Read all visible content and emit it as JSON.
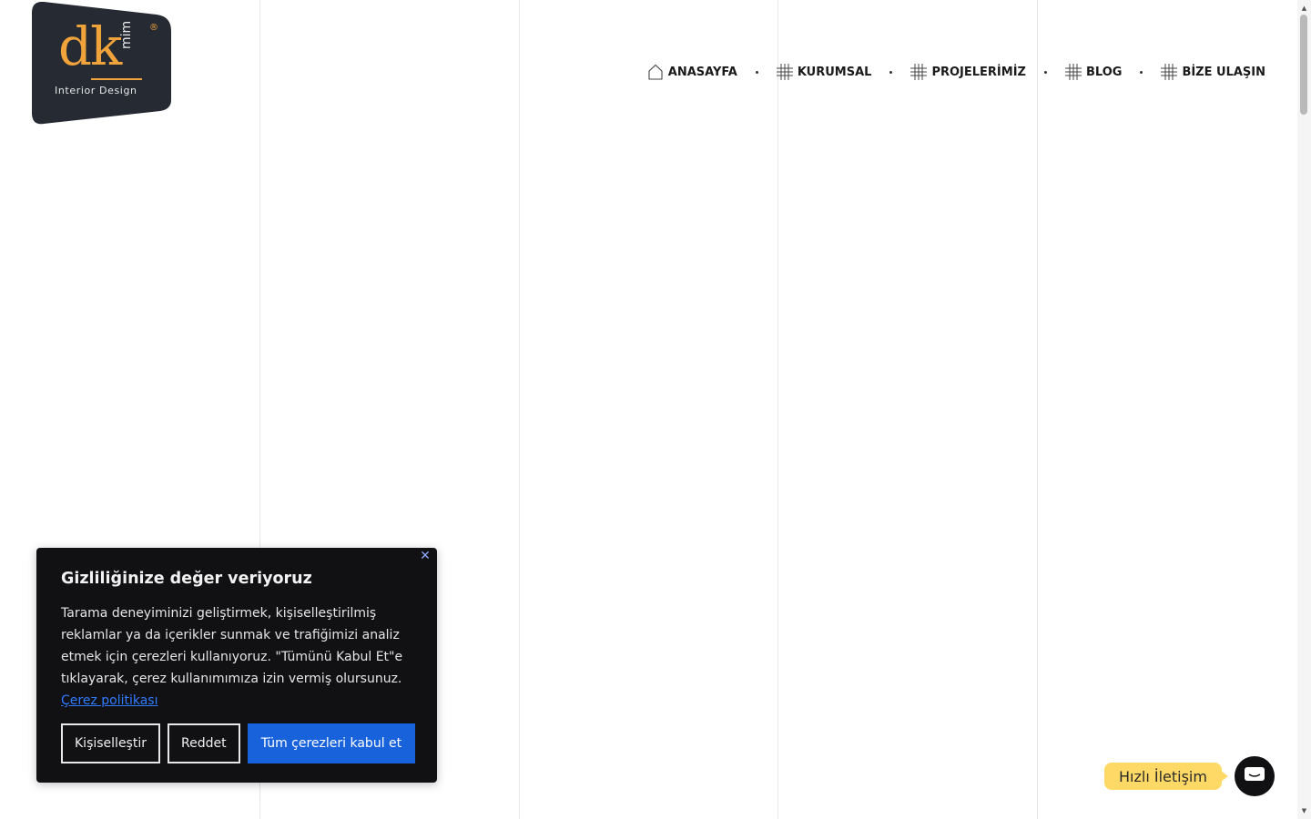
{
  "logo": {
    "brand": "dk",
    "brand_suffix": "mim",
    "registered": "®",
    "tagline": "Interior Design"
  },
  "nav": {
    "items": [
      {
        "label": "ANASAYFA",
        "icon": "home-icon"
      },
      {
        "label": "KURUMSAL",
        "icon": "grid-icon"
      },
      {
        "label": "PROJELERİMİZ",
        "icon": "grid-icon"
      },
      {
        "label": "BLOG",
        "icon": "grid-icon"
      },
      {
        "label": "BİZE ULAŞIN",
        "icon": "grid-icon"
      }
    ]
  },
  "cookie": {
    "title": "Gizliliğinize değer veriyoruz",
    "text": "Tarama deneyiminizi geliştirmek, kişiselleştirilmiş reklamlar ya da içerikler sunmak ve trafiğimizi analiz etmek için çerezleri kullanıyoruz. \"Tümünü Kabul Et\"e tıklayarak, çerez kullanımımıza izin vermiş olursunuz.",
    "link": "Çerez politikası",
    "buttons": {
      "customize": "Kişiselleştir",
      "reject": "Reddet",
      "accept_all": "Tüm çerezleri kabul et"
    },
    "close_icon": "close-icon"
  },
  "quick_contact": {
    "label": "Hızlı İletişim",
    "icon": "chat-icon"
  },
  "colors": {
    "accent": "#f0a33a",
    "logo_bg": "#262a33",
    "cookie_bg": "#111114",
    "primary_button": "#1863dc",
    "quick_contact_bg": "#ffd966"
  }
}
